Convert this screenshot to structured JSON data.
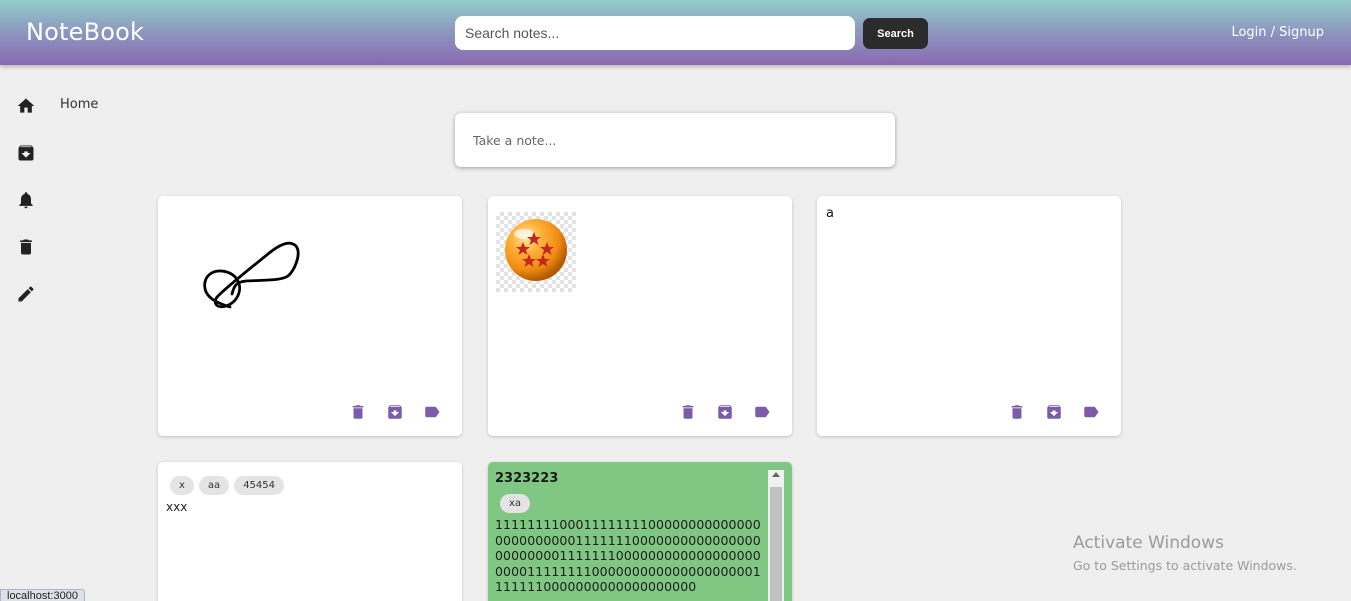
{
  "header": {
    "brand": "NoteBook",
    "search_placeholder": "Search notes...",
    "search_button": "Search",
    "login_label": "Login / Signup"
  },
  "sidebar": {
    "items": [
      {
        "icon": "home-icon",
        "label": "Home"
      },
      {
        "icon": "archive-icon"
      },
      {
        "icon": "bell-icon"
      },
      {
        "icon": "trash-icon"
      },
      {
        "icon": "pencil-icon"
      }
    ]
  },
  "composer": {
    "placeholder": "Take a note..."
  },
  "notes": [
    {
      "type": "drawing"
    },
    {
      "type": "image",
      "image": "dragon-ball-icon"
    },
    {
      "type": "text",
      "text": "a"
    },
    {
      "type": "text",
      "labels": [
        "x",
        "aa",
        "45454"
      ],
      "text": "xxx"
    },
    {
      "type": "text",
      "color": "#81c784",
      "title": "2323223",
      "labels": [
        "xa"
      ],
      "text": "1111111100011111111000000000000000000000000111111100000000000000000000000011111110000000000000000000000111111110000000000000000000011111110000000000000000000"
    }
  ],
  "watermark": {
    "title": "Activate Windows",
    "subtitle": "Go to Settings to activate Windows."
  },
  "status_bar": {
    "url": "localhost:3000"
  },
  "colors": {
    "accent": "#7c5bab",
    "header_top": "#94cfcb",
    "header_bottom": "#8a69b2",
    "green_note": "#81c784"
  }
}
